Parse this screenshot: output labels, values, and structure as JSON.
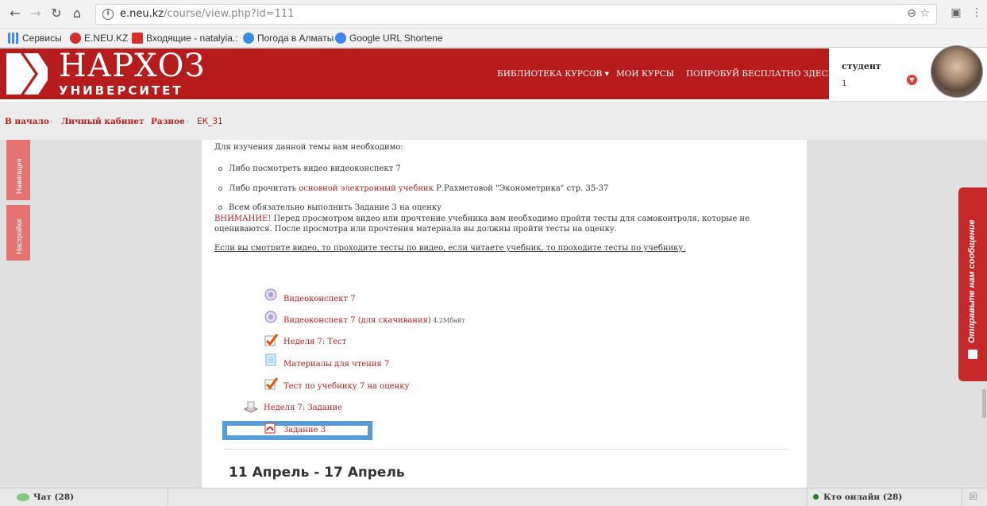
{
  "browser": {
    "url_host": "e.neu.kz",
    "url_path": "/course/view.php?id=111",
    "bookmarks": [
      {
        "label": "Сервисы",
        "color": "#4285f4"
      },
      {
        "label": "E.NEU.KZ",
        "color": "#d32f2f"
      },
      {
        "label": "Входящие - natalyia.:",
        "color": "#d93025"
      },
      {
        "label": "Погода в Алматы",
        "color": "#3b8ede"
      },
      {
        "label": "Google URL Shortene",
        "color": "#4285f4"
      }
    ]
  },
  "header": {
    "logo_top": "НАРХОЗ",
    "logo_bottom": "УНИВЕРСИТЕТ",
    "nav": [
      {
        "label": "БИБЛИОТЕКА КУРСОВ ▾"
      },
      {
        "label": "МОИ КУРСЫ"
      },
      {
        "label": "ПОПРОБУЙ БЕСПЛАТНО ЗДЕСЬ!"
      }
    ],
    "user": {
      "name": "студент",
      "id": "1"
    },
    "brand_color": "#b71c1c"
  },
  "breadcrumb": [
    "В начало",
    "Личный кабинет",
    "Разное",
    "ЕК_31"
  ],
  "sidebar_tabs": [
    "Навигация",
    "Настройки"
  ],
  "content": {
    "intro": "Для изучения данной темы вам необходимо:",
    "bullets": [
      {
        "text": "Либо посмотреть видео видеоконспект 7"
      },
      {
        "pre": "Либо прочитать ",
        "link": "основной электронный учебник",
        "post": " Р.Рахметовой \"Эконометрика\" стр. 35-37"
      },
      {
        "text": "Всем обязательно выполнить Задание 3 на оценку"
      }
    ],
    "warning_label": "ВНИМАНИЕ!",
    "warning_line1": " Перед просмотром видео или прочтение учебника вам необходимо пройти тесты для самоконтроля, которые не",
    "warning_line2": "оцениваются. После просмотра или прочтения материала вы должны пройти тесты на оценку.",
    "note": "Если вы смотрите видео, то проходите тесты по видео, если читаете учебник, то проходите тесты по учебнику.",
    "activities": [
      {
        "icon": "video-icon",
        "label": "Видеоконспект 7",
        "size": ""
      },
      {
        "icon": "video-icon",
        "label": "Видеоконспект 7 (для скачивания)",
        "size": " 4.2Мбайт"
      },
      {
        "icon": "quiz-icon",
        "label": "Неделя 7: Тест",
        "size": ""
      },
      {
        "icon": "document-icon",
        "label": "Материалы для чтения 7",
        "size": ""
      },
      {
        "icon": "quiz-icon",
        "label": "Тест по учебнику 7 на оценку",
        "size": ""
      }
    ],
    "assignment_section": {
      "icon": "assignment-icon",
      "label": "Неделя 7: Задание"
    },
    "assignment_item": {
      "icon": "pdf-icon",
      "label": "Задание 3"
    },
    "next_week": "11 Апрель - 17 Апрель"
  },
  "feedback_tab": "Отправьте нам сообщение",
  "bottombar": {
    "chat": "Чат (28)",
    "online": "Кто онлайн (28)"
  }
}
